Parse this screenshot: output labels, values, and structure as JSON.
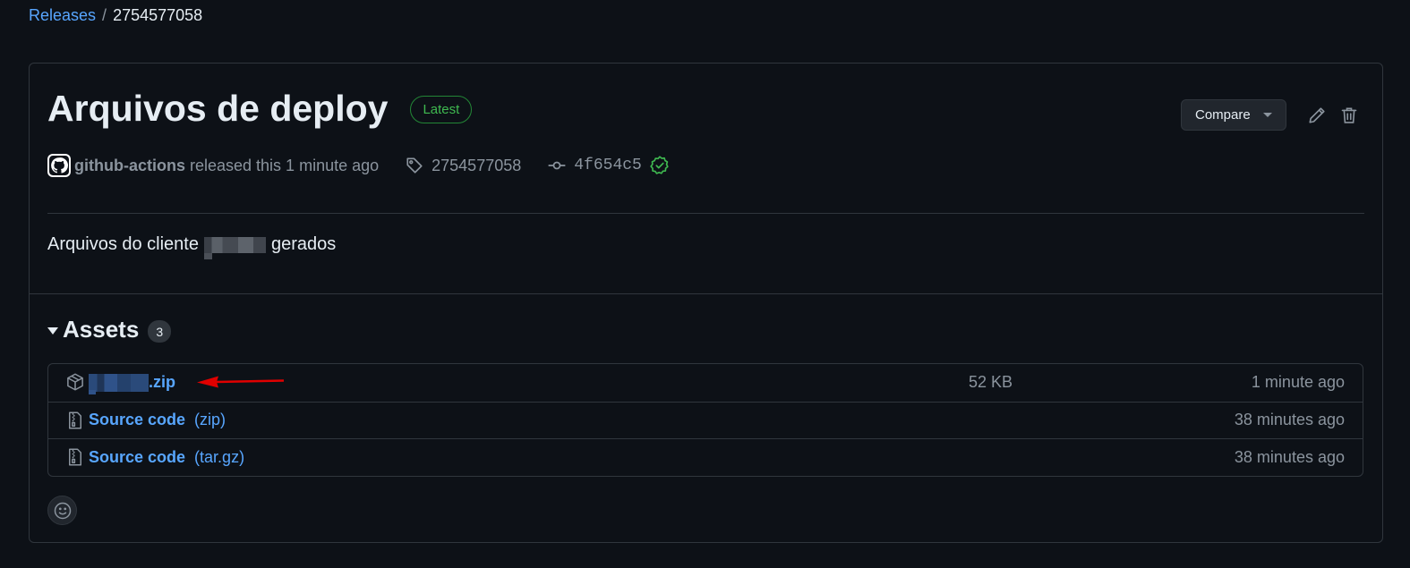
{
  "breadcrumb": {
    "releases_label": "Releases",
    "separator": "/",
    "current": "2754577058"
  },
  "release": {
    "title": "Arquivos de deploy",
    "badge": "Latest",
    "compare_label": "Compare",
    "author": "github-actions",
    "released_text": "released this 1 minute ago",
    "tag": "2754577058",
    "commit": "4f654c5",
    "description_before": "Arquivos do cliente",
    "description_after": "gerados"
  },
  "assets": {
    "label": "Assets",
    "count": "3",
    "items": [
      {
        "name_suffix": ".zip",
        "ext": "",
        "size": "52 KB",
        "time": "1 minute ago",
        "icon": "package-icon"
      },
      {
        "name": "Source code",
        "ext": "(zip)",
        "size": "",
        "time": "38 minutes ago",
        "icon": "file-zip-icon"
      },
      {
        "name": "Source code",
        "ext": "(tar.gz)",
        "size": "",
        "time": "38 minutes ago",
        "icon": "file-zip-icon"
      }
    ]
  },
  "colors": {
    "background": "#0d1117",
    "link": "#58a6ff",
    "muted": "#8b949e",
    "border": "#30363d",
    "success": "#3fb950",
    "annotation_arrow": "#e00000"
  }
}
